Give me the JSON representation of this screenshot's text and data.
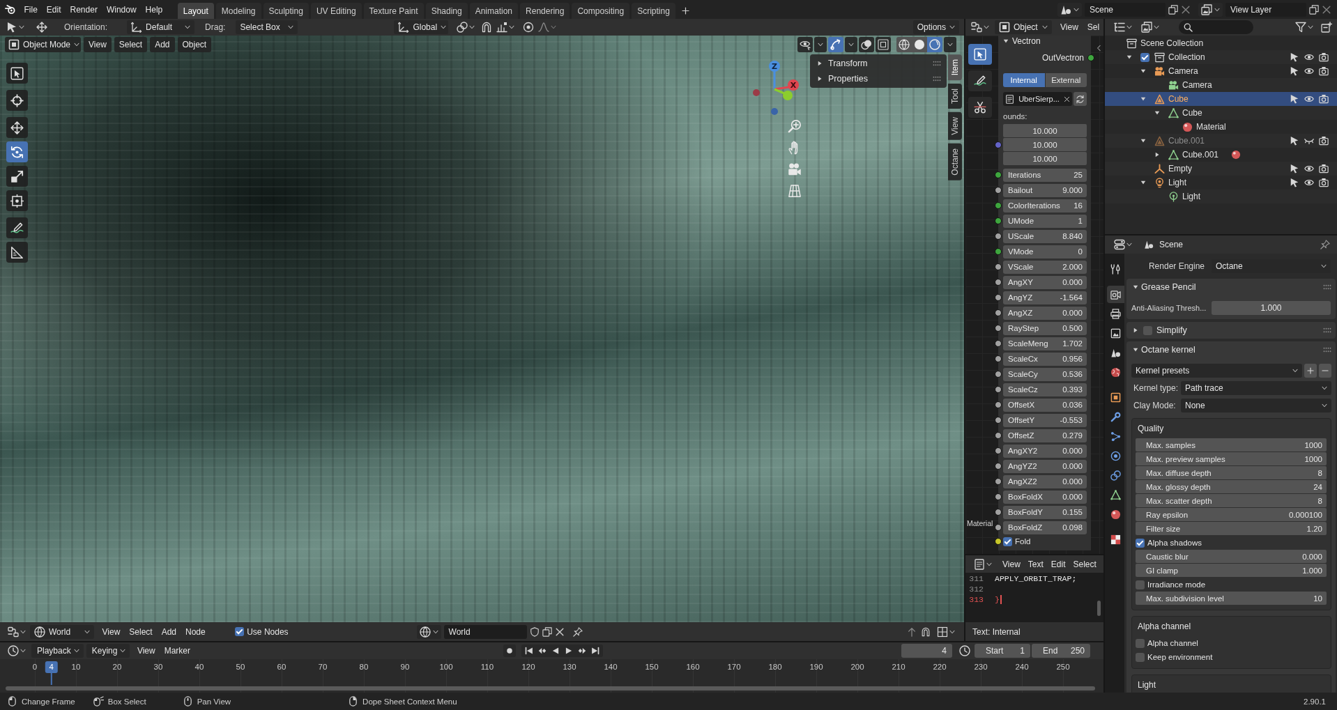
{
  "topbar": {
    "menus": [
      "File",
      "Edit",
      "Render",
      "Window",
      "Help"
    ],
    "workspaces": [
      {
        "label": "Layout",
        "selected": true
      },
      {
        "label": "Modeling",
        "selected": false
      },
      {
        "label": "Sculpting",
        "selected": false
      },
      {
        "label": "UV Editing",
        "selected": false
      },
      {
        "label": "Texture Paint",
        "selected": false
      },
      {
        "label": "Shading",
        "selected": false
      },
      {
        "label": "Animation",
        "selected": false
      },
      {
        "label": "Rendering",
        "selected": false
      },
      {
        "label": "Compositing",
        "selected": false
      },
      {
        "label": "Scripting",
        "selected": false
      }
    ],
    "scene": "Scene",
    "view_layer": "View Layer"
  },
  "tool_settings": {
    "orientation_label": "Orientation:",
    "orientation": "Default",
    "drag_label": "Drag:",
    "drag": "Select Box",
    "transform_orientation": "Global",
    "options": "Options"
  },
  "viewport": {
    "mode": "Object Mode",
    "menus": [
      "View",
      "Select",
      "Add",
      "Object"
    ],
    "tools": [
      {
        "kind": "select-box",
        "selected": false
      },
      {
        "kind": "cursor",
        "selected": false
      },
      {
        "kind": "move",
        "selected": false
      },
      {
        "kind": "rotate",
        "selected": true
      },
      {
        "kind": "scale",
        "selected": false
      },
      {
        "kind": "transform",
        "selected": false
      },
      {
        "kind": "annotate",
        "selected": false
      },
      {
        "kind": "measure",
        "selected": false
      }
    ],
    "overlay_toggles": [
      {
        "kind": "visibility",
        "on": false
      },
      {
        "kind": "gizmo",
        "on": true
      },
      {
        "kind": "overlays",
        "on": false
      },
      {
        "kind": "xray",
        "on": false
      }
    ],
    "shading": [
      {
        "kind": "wireframe",
        "selected": false
      },
      {
        "kind": "solid",
        "selected": false
      },
      {
        "kind": "rendered",
        "selected": true
      }
    ],
    "gizmo": {
      "z_label": "Z",
      "x_label": "X"
    },
    "sidebar": {
      "panels": [
        {
          "title": "Transform",
          "expanded": false
        },
        {
          "title": "Properties",
          "expanded": false
        }
      ],
      "tabs": [
        {
          "label": "Item",
          "selected": true
        },
        {
          "label": "Tool",
          "selected": false
        },
        {
          "label": "View",
          "selected": false
        },
        {
          "label": "Octane",
          "selected": false
        }
      ]
    }
  },
  "shader_header": {
    "type": "World",
    "menus": [
      "View",
      "Select",
      "Add",
      "Node"
    ],
    "use_nodes": {
      "label": "Use Nodes",
      "checked": true
    },
    "datablock": "World"
  },
  "node_editor": {
    "type": "Object",
    "menus": [
      "View",
      "Sel"
    ],
    "tools": [
      {
        "kind": "select-box",
        "selected": true
      },
      {
        "kind": "annotate",
        "selected": false
      },
      {
        "kind": "cut",
        "selected": false
      }
    ],
    "node": {
      "title": "Vectron",
      "expanded": true,
      "output": {
        "label": "OutVectron",
        "color": "#3ea63e"
      },
      "sources": [
        {
          "label": "Internal",
          "selected": true
        },
        {
          "label": "External",
          "selected": false
        }
      ],
      "text": "UberSierp...",
      "bounds": {
        "label": "ounds:",
        "color": "#6363c7",
        "values": [
          "10.000",
          "10.000",
          "10.000"
        ]
      },
      "params": [
        {
          "name": "Iterations",
          "value": "25",
          "color": "#3ea63e"
        },
        {
          "name": "Bailout",
          "value": "9.000",
          "color": "#a1a1a1"
        },
        {
          "name": "ColorIterations",
          "value": "16",
          "color": "#3ea63e"
        },
        {
          "name": "UMode",
          "value": "1",
          "color": "#3ea63e"
        },
        {
          "name": "UScale",
          "value": "8.840",
          "color": "#a1a1a1"
        },
        {
          "name": "VMode",
          "value": "0",
          "color": "#3ea63e"
        },
        {
          "name": "VScale",
          "value": "2.000",
          "color": "#a1a1a1"
        },
        {
          "name": "AngXY",
          "value": "0.000",
          "color": "#a1a1a1"
        },
        {
          "name": "AngYZ",
          "value": "-1.564",
          "color": "#a1a1a1"
        },
        {
          "name": "AngXZ",
          "value": "0.000",
          "color": "#a1a1a1"
        },
        {
          "name": "RayStep",
          "value": "0.500",
          "color": "#a1a1a1"
        },
        {
          "name": "ScaleMeng",
          "value": "1.702",
          "color": "#a1a1a1"
        },
        {
          "name": "ScaleCx",
          "value": "0.956",
          "color": "#a1a1a1"
        },
        {
          "name": "ScaleCy",
          "value": "0.536",
          "color": "#a1a1a1"
        },
        {
          "name": "ScaleCz",
          "value": "0.393",
          "color": "#a1a1a1"
        },
        {
          "name": "OffsetX",
          "value": "0.036",
          "color": "#a1a1a1"
        },
        {
          "name": "OffsetY",
          "value": "-0.553",
          "color": "#a1a1a1"
        },
        {
          "name": "OffsetZ",
          "value": "0.279",
          "color": "#a1a1a1"
        },
        {
          "name": "AngXY2",
          "value": "0.000",
          "color": "#a1a1a1"
        },
        {
          "name": "AngYZ2",
          "value": "0.000",
          "color": "#a1a1a1"
        },
        {
          "name": "AngXZ2",
          "value": "0.000",
          "color": "#a1a1a1"
        },
        {
          "name": "BoxFoldX",
          "value": "0.000",
          "color": "#a1a1a1"
        },
        {
          "name": "BoxFoldY",
          "value": "0.155",
          "color": "#a1a1a1"
        },
        {
          "name": "BoxFoldZ",
          "value": "0.098",
          "color": "#a1a1a1"
        }
      ],
      "fold": {
        "label": "Fold",
        "checked": true,
        "color": "#c7c729"
      }
    },
    "frame_label": "Material"
  },
  "text_editor": {
    "menus": [
      "View",
      "Text",
      "Edit",
      "Select"
    ],
    "lines": [
      {
        "number": "311",
        "code": "APPLY_ORBIT_TRAP;",
        "highlighted": false
      },
      {
        "number": "312",
        "highlighted": false
      },
      {
        "number": "313",
        "code": "}",
        "highlighted": true
      }
    ],
    "footer": "Text: Internal"
  },
  "timeline": {
    "menus": [
      {
        "label": "Playback",
        "kind": "dropdown"
      },
      {
        "label": "Keying",
        "kind": "dropdown"
      },
      {
        "label": "View",
        "kind": "menu"
      },
      {
        "label": "Marker",
        "kind": "menu"
      }
    ],
    "current_frame": "4",
    "start_label": "Start",
    "start": "1",
    "end_label": "End",
    "end": "250",
    "ruler": [
      "0",
      "10",
      "20",
      "30",
      "40",
      "50",
      "60",
      "70",
      "80",
      "90",
      "100",
      "110",
      "120",
      "130",
      "140",
      "150",
      "160",
      "170",
      "180",
      "190",
      "200",
      "210",
      "220",
      "230",
      "240",
      "250"
    ],
    "playhead": "4"
  },
  "status_bar": {
    "hints": [
      {
        "kind": "mouse-left",
        "label": "Change Frame"
      },
      {
        "kind": "mouse-drag",
        "label": "Box Select"
      },
      {
        "kind": "mouse-middle",
        "label": "Pan View"
      },
      {
        "kind": "mouse-right",
        "label": "Dope Sheet Context Menu"
      }
    ],
    "version": "2.90.1"
  },
  "outliner": {
    "tree": [
      {
        "label": "Scene Collection",
        "kind": "scene-collection",
        "selected": false,
        "children": [
          {
            "label": "Collection",
            "kind": "collection",
            "expanded": true,
            "checked": true,
            "visible": true,
            "selected": false,
            "children": [
              {
                "label": "Camera",
                "kind": "camera-object",
                "expanded": true,
                "visible": true,
                "selected": false,
                "children": [
                  {
                    "label": "Camera",
                    "kind": "camera-data",
                    "selected": false
                  }
                ]
              },
              {
                "label": "Cube",
                "kind": "mesh-object",
                "expanded": true,
                "visible": true,
                "selected": true,
                "children": [
                  {
                    "label": "Cube",
                    "kind": "mesh-data",
                    "expanded": true,
                    "selected": false,
                    "children": [
                      {
                        "label": "Material",
                        "kind": "material",
                        "selected": false
                      }
                    ]
                  }
                ]
              },
              {
                "label": "Cube.001",
                "kind": "mesh-object",
                "expanded": true,
                "visible": false,
                "selected": false,
                "children": [
                  {
                    "label": "Cube.001",
                    "kind": "mesh-data",
                    "expanded": false,
                    "material_badge": true,
                    "selected": false
                  }
                ]
              },
              {
                "label": "Empty",
                "kind": "empty",
                "visible": true,
                "selected": false
              },
              {
                "label": "Light",
                "kind": "light-object",
                "expanded": true,
                "visible": true,
                "selected": false,
                "children": [
                  {
                    "label": "Light",
                    "kind": "light-data",
                    "selected": false
                  }
                ]
              }
            ]
          }
        ]
      }
    ]
  },
  "properties": {
    "breadcrumb": "Scene",
    "tabs": [
      {
        "kind": "tool",
        "selected": false
      },
      {
        "kind": "render",
        "selected": true
      },
      {
        "kind": "output",
        "selected": false
      },
      {
        "kind": "view-layer",
        "selected": false
      },
      {
        "kind": "scene",
        "selected": false
      },
      {
        "kind": "world",
        "selected": false
      },
      {
        "kind": "object",
        "selected": false
      },
      {
        "kind": "modifiers",
        "selected": false
      },
      {
        "kind": "particles",
        "selected": false
      },
      {
        "kind": "physics",
        "selected": false
      },
      {
        "kind": "constraints",
        "selected": false
      },
      {
        "kind": "data",
        "selected": false
      },
      {
        "kind": "material",
        "selected": false
      },
      {
        "kind": "texture",
        "selected": false
      }
    ],
    "render_engine": {
      "label": "Render Engine",
      "value": "Octane"
    },
    "grease_pencil": {
      "title": "Grease Pencil",
      "expanded": true,
      "label": "Anti-Aliasing Thresh...",
      "value": "1.000"
    },
    "simplify": {
      "title": "Simplify",
      "expanded": false,
      "checked": false
    },
    "octane_kernel": {
      "title": "Octane kernel",
      "expanded": true,
      "presets": "Kernel presets",
      "kernel_type_label": "Kernel type:",
      "kernel_type": "Path trace",
      "clay_label": "Clay Mode:",
      "clay": "None",
      "subpanels": [
        {
          "title": "Quality",
          "rows": [
            {
              "kind": "number",
              "label": "Max. samples",
              "value": "1000"
            },
            {
              "kind": "number",
              "label": "Max. preview samples",
              "value": "1000"
            },
            {
              "kind": "number",
              "label": "Max. diffuse depth",
              "value": "8"
            },
            {
              "kind": "number",
              "label": "Max. glossy depth",
              "value": "24"
            },
            {
              "kind": "number",
              "label": "Max. scatter depth",
              "value": "8"
            },
            {
              "kind": "number",
              "label": "Ray epsilon",
              "value": "0.000100"
            },
            {
              "kind": "number",
              "label": "Filter size",
              "value": "1.20"
            },
            {
              "kind": "checkbox",
              "label": "Alpha shadows",
              "checked": true
            },
            {
              "kind": "number",
              "label": "Caustic blur",
              "value": "0.000"
            },
            {
              "kind": "number",
              "label": "GI clamp",
              "value": "1.000"
            },
            {
              "kind": "checkbox",
              "label": "Irradiance mode",
              "checked": false
            },
            {
              "kind": "number",
              "label": "Max. subdivision level",
              "value": "10"
            }
          ]
        },
        {
          "title": "Alpha channel",
          "rows": [
            {
              "kind": "checkbox",
              "label": "Alpha channel",
              "checked": false
            },
            {
              "kind": "checkbox",
              "label": "Keep environment",
              "checked": false
            }
          ]
        },
        {
          "title": "Light"
        }
      ]
    }
  }
}
